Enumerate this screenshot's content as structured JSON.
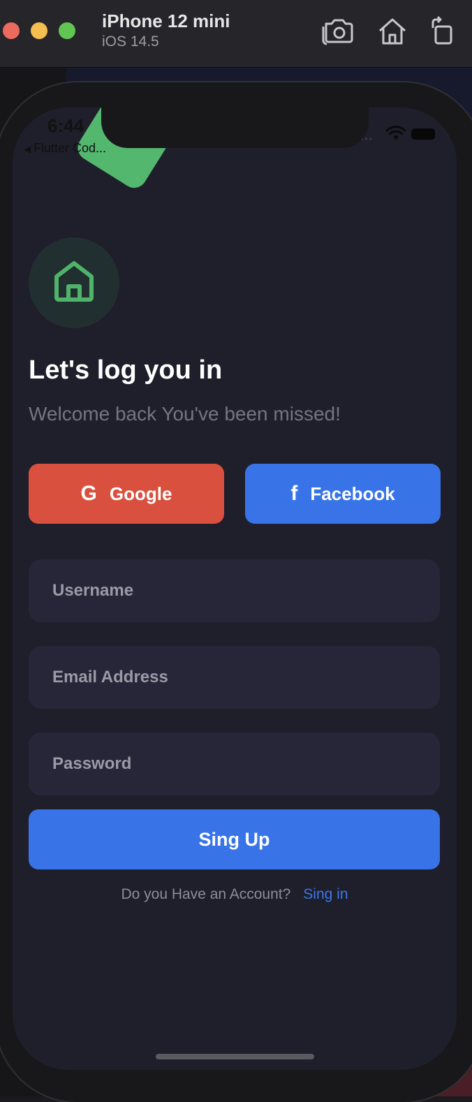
{
  "simulator": {
    "device_name": "iPhone 12 mini",
    "os_version": "iOS 14.5",
    "toolbar_icons": [
      "screenshot-icon",
      "home-icon",
      "rotate-icon"
    ]
  },
  "status_bar": {
    "time": "6:44",
    "back_app": "Flutter Cod..."
  },
  "login": {
    "title": "Let's log you in",
    "subtitle": "Welcome back You've been missed!",
    "google_icon": "G",
    "google_label": "Google",
    "facebook_icon": "f",
    "facebook_label": "Facebook",
    "username_placeholder": "Username",
    "email_placeholder": "Email Address",
    "password_placeholder": "Password",
    "signup_label": "Sing Up",
    "account_question": "Do you Have an Account?",
    "signin_link": "Sing in"
  },
  "colors": {
    "background": "#1f1e2b",
    "accent_green": "#53b76e",
    "google_red": "#d9503f",
    "facebook_blue": "#3874e8",
    "field_bg": "#262638"
  }
}
